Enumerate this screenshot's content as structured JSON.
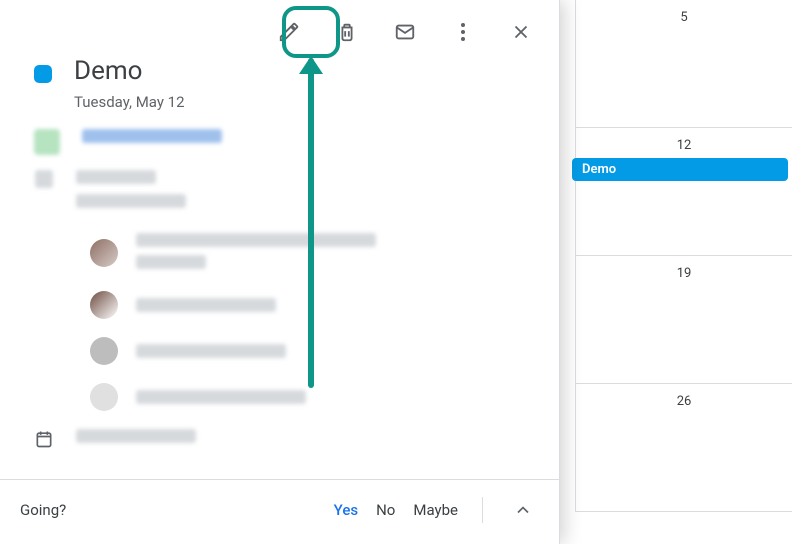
{
  "event": {
    "title": "Demo",
    "date": "Tuesday, May 12",
    "color": "#039be5"
  },
  "guests": [
    {
      "name_redacted": true
    },
    {
      "name_redacted": true
    },
    {
      "name_redacted": true
    },
    {
      "name_redacted": true
    }
  ],
  "rsvp": {
    "question": "Going?",
    "yes": "Yes",
    "no": "No",
    "maybe": "Maybe",
    "selected": "Yes"
  },
  "calendar": {
    "days": [
      {
        "day": "5"
      },
      {
        "day": "12",
        "event_title": "Demo"
      },
      {
        "day": "19"
      },
      {
        "day": "26"
      }
    ]
  },
  "icons": {
    "edit": "pencil-icon",
    "delete": "trash-icon",
    "email": "mail-icon",
    "more": "more-icon",
    "close": "close-icon",
    "calendar": "calendar-icon",
    "expand": "chevron-up-icon"
  }
}
